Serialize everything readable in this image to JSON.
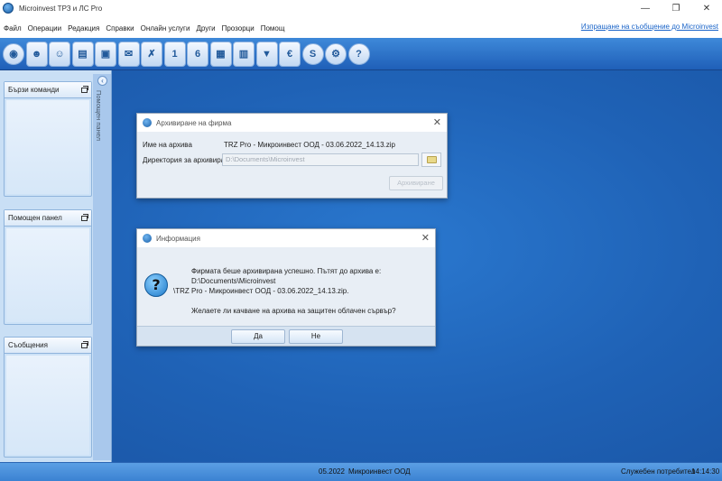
{
  "window": {
    "title": "Microinvest ТРЗ и ЛС Pro",
    "controls": {
      "minimize": "—",
      "restore": "❐",
      "close": "✕"
    }
  },
  "menu": {
    "items": [
      "Файл",
      "Операции",
      "Редакция",
      "Справки",
      "Онлайн услуги",
      "Други",
      "Прозорци",
      "Помощ"
    ],
    "message_link": "Изпращане на съобщение до Microinvest"
  },
  "toolbar": {
    "buttons": [
      {
        "icon": "globe-icon",
        "glyph": "◉"
      },
      {
        "icon": "employees-icon",
        "glyph": "☻"
      },
      {
        "icon": "people-icon",
        "glyph": "☺"
      },
      {
        "icon": "contract-icon",
        "glyph": "▤"
      },
      {
        "icon": "person-card-icon",
        "glyph": "▣"
      },
      {
        "icon": "leave-icon",
        "glyph": "✉"
      },
      {
        "icon": "absence-icon",
        "glyph": "✗"
      },
      {
        "icon": "document-1-icon",
        "glyph": "1"
      },
      {
        "icon": "document-6-icon",
        "glyph": "6"
      },
      {
        "icon": "reports-icon",
        "glyph": "▦"
      },
      {
        "icon": "payroll-icon",
        "glyph": "▥"
      },
      {
        "icon": "download-icon",
        "glyph": "▼"
      },
      {
        "icon": "euro-icon",
        "glyph": "€"
      },
      {
        "icon": "skype-icon",
        "glyph": "S"
      },
      {
        "icon": "settings-icon",
        "glyph": "⚙"
      },
      {
        "icon": "help-icon",
        "glyph": "?"
      }
    ]
  },
  "side": {
    "strip_label": "Помощен панел",
    "collapse_glyph": "‹",
    "panels": [
      {
        "title": "Бързи команди"
      },
      {
        "title": "Помощен панел"
      },
      {
        "title": "Съобщения"
      }
    ]
  },
  "archive_dialog": {
    "title": "Архивиране на фирма",
    "name_label": "Име на архива",
    "name_value": "TRZ Pro - Микроинвест ООД - 03.06.2022_14.13.zip",
    "dir_label": "Директория за архивиране",
    "dir_value": "D:\\Documents\\Microinvest",
    "archive_button": "Архивиране",
    "close": "✕"
  },
  "info_dialog": {
    "title": "Информация",
    "close": "✕",
    "icon_glyph": "?",
    "message_line1": "Фирмата беше архивирана успешно. Пътят до архива е: D:\\Documents\\Microinvest",
    "message_line2": "\\TRZ Pro - Микроинвест ООД - 03.06.2022_14.13.zip.",
    "question": "Желаете ли качване на архива на защитен облачен сървър?",
    "yes": "Да",
    "no": "Не"
  },
  "status": {
    "period": "05.2022",
    "company": "Микроинвест ООД",
    "user": "Служебен потребител",
    "time": "14:14:30"
  }
}
